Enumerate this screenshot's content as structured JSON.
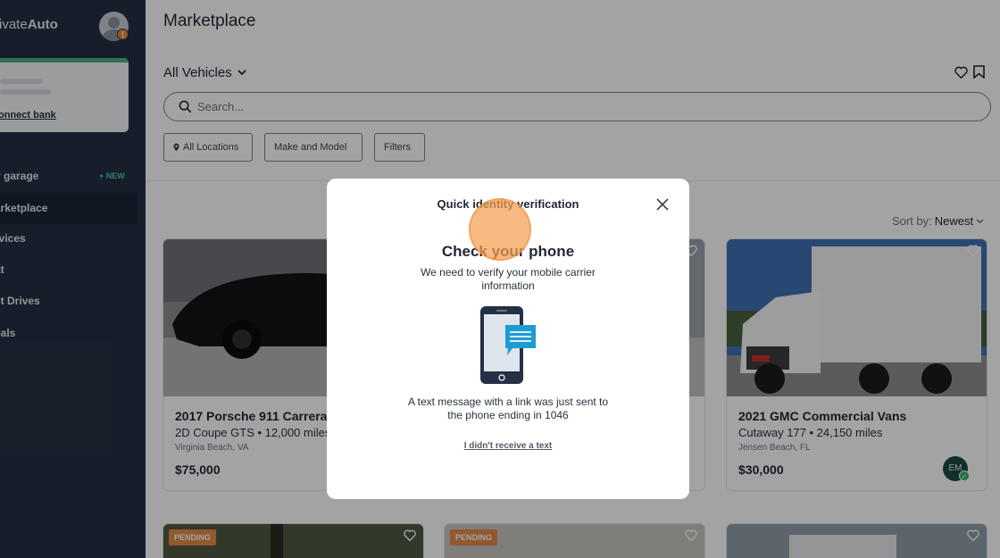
{
  "sidebar": {
    "logo_light": "rivate",
    "logo_bold": "Auto",
    "avatar_badge": "!",
    "bank_link": "onnect bank",
    "items": [
      {
        "label": "y garage"
      },
      {
        "label": "arketplace"
      },
      {
        "label": "rvices"
      },
      {
        "label": "at"
      },
      {
        "label": "st Drives"
      },
      {
        "label": "eals"
      }
    ],
    "new_badge": "+ NEW"
  },
  "main": {
    "title": "Marketplace",
    "vehicle_filter": "All Vehicles",
    "search_placeholder": "Search...",
    "filters": [
      "All Locations",
      "Make and Model",
      "Filters"
    ],
    "sort_label": "Sort by:",
    "sort_value": "Newest"
  },
  "listings": [
    {
      "title": "2017 Porsche 911 Carrera",
      "subtitle": "2D Coupe GTS • 12,000 miles",
      "location": "Virginia Beach, VA",
      "price": "$75,000"
    },
    {
      "title": "2021 GMC Commercial Vans",
      "subtitle": "Cutaway 177 • 24,150 miles",
      "location": "Jensen Beach, FL",
      "price": "$30,000",
      "seller_initials": "EM"
    }
  ],
  "bottom_row": {
    "pending_label_1": "PENDING",
    "pending_label_2": "PENDING"
  },
  "modal": {
    "title": "Quick identity verification",
    "heading": "Check your phone",
    "description": "We need to verify your mobile carrier information",
    "message": "A text message with a link was just sent to the phone ending in 1046",
    "resend_link": "I didn't receive a text"
  },
  "colors": {
    "sidebar": "#243044",
    "accent_green": "#4fb18a",
    "pending": "#e48a4a",
    "phone_screen": "#1e9bd4"
  }
}
